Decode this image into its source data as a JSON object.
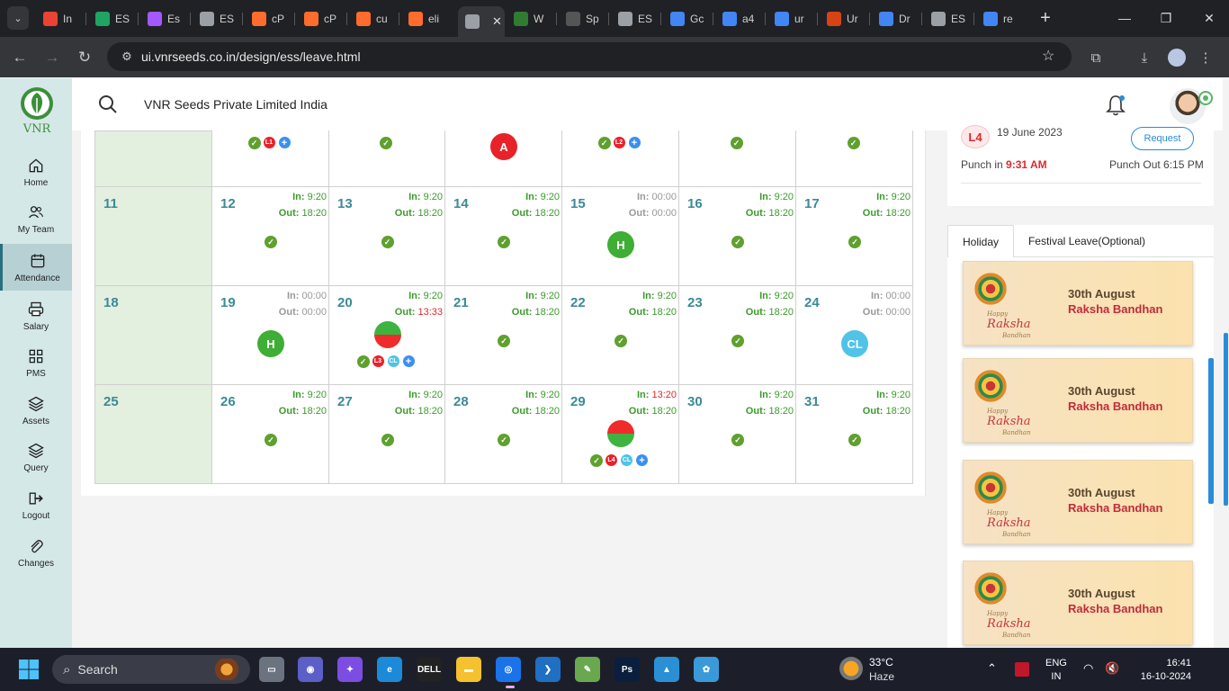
{
  "browser": {
    "tabs": [
      {
        "title": "In",
        "icon": "gmail-icon",
        "color": "#ea4335"
      },
      {
        "title": "ES",
        "icon": "sheets-icon",
        "color": "#1fa463"
      },
      {
        "title": "Es",
        "icon": "figma-icon",
        "color": "#a259ff"
      },
      {
        "title": "ES",
        "icon": "globe-icon",
        "color": "#9aa0a6"
      },
      {
        "title": "cP",
        "icon": "cpanel-icon",
        "color": "#ff6c2c"
      },
      {
        "title": "cP",
        "icon": "cpanel-icon",
        "color": "#ff6c2c"
      },
      {
        "title": "cu",
        "icon": "cpanel-icon",
        "color": "#ff6c2c"
      },
      {
        "title": "eli",
        "icon": "cpanel-icon",
        "color": "#ff6c2c"
      },
      {
        "title": "",
        "icon": "globe-icon",
        "color": "#9aa0a6",
        "active": true
      },
      {
        "title": "W",
        "icon": "chart-icon",
        "color": "#2e7d32"
      },
      {
        "title": "Sp",
        "icon": "spreadsheet-icon",
        "color": "#555"
      },
      {
        "title": "ES",
        "icon": "globe-icon",
        "color": "#9aa0a6"
      },
      {
        "title": "Gc",
        "icon": "google-icon",
        "color": "#4285f4"
      },
      {
        "title": "a4",
        "icon": "google-icon",
        "color": "#4285f4"
      },
      {
        "title": "ur",
        "icon": "google-icon",
        "color": "#4285f4"
      },
      {
        "title": "Ur",
        "icon": "kiu-icon",
        "color": "#d84315"
      },
      {
        "title": "Dr",
        "icon": "google-icon",
        "color": "#4285f4"
      },
      {
        "title": "ES",
        "icon": "globe-icon",
        "color": "#9aa0a6"
      },
      {
        "title": "re",
        "icon": "google-icon",
        "color": "#4285f4"
      }
    ],
    "url": "ui.vnrseeds.co.in/design/ess/leave.html"
  },
  "sidebar": {
    "logo_text": "VNR",
    "items": [
      {
        "label": "Home",
        "icon": "home-icon"
      },
      {
        "label": "My Team",
        "icon": "team-icon"
      },
      {
        "label": "Attendance",
        "icon": "calendar-icon",
        "active": true
      },
      {
        "label": "Salary",
        "icon": "printer-icon"
      },
      {
        "label": "PMS",
        "icon": "grid-icon"
      },
      {
        "label": "Assets",
        "icon": "layers-icon"
      },
      {
        "label": "Query",
        "icon": "layers-icon"
      },
      {
        "label": "Logout",
        "icon": "logout-icon"
      },
      {
        "label": "Changes",
        "icon": "paperclip-icon"
      }
    ]
  },
  "header": {
    "company": "VNR Seeds Private Limited India"
  },
  "calendar": {
    "top_row": [
      {
        "marks": [
          "check",
          "L1",
          "plus"
        ]
      },
      {
        "marks": [
          "check"
        ]
      },
      {
        "bubble": "A",
        "color": "#e8222a"
      },
      {
        "marks": [
          "check",
          "L2",
          "plus"
        ]
      },
      {
        "marks": [
          "check"
        ]
      },
      {
        "marks": [
          "check"
        ]
      }
    ],
    "weeks": [
      [
        {
          "day": "11",
          "sunday": true
        },
        {
          "day": "12",
          "in": "9:20",
          "out": "18:20",
          "status": "check"
        },
        {
          "day": "13",
          "in": "9:20",
          "out": "18:20",
          "status": "check"
        },
        {
          "day": "14",
          "in": "9:20",
          "out": "18:20",
          "status": "check"
        },
        {
          "day": "15",
          "in": "00:00",
          "out": "00:00",
          "grey": true,
          "bubble": "H",
          "bubble_color": "#3fae34"
        },
        {
          "day": "16",
          "in": "9:20",
          "out": "18:20",
          "status": "check"
        },
        {
          "day": "17",
          "in": "9:20",
          "out": "18:20",
          "status": "check"
        }
      ],
      [
        {
          "day": "18",
          "sunday": true
        },
        {
          "day": "19",
          "in": "00:00",
          "out": "00:00",
          "grey": true,
          "bubble": "H",
          "bubble_color": "#3fae34"
        },
        {
          "day": "20",
          "in": "9:20",
          "out": "13:33",
          "out_red": true,
          "split": "green-top",
          "marks": [
            "check",
            "L3",
            "CL",
            "plus"
          ]
        },
        {
          "day": "21",
          "in": "9:20",
          "out": "18:20",
          "status": "check"
        },
        {
          "day": "22",
          "in": "9:20",
          "out": "18:20",
          "status": "check"
        },
        {
          "day": "23",
          "in": "9:20",
          "out": "18:20",
          "status": "check"
        },
        {
          "day": "24",
          "in": "00:00",
          "out": "00:00",
          "grey": true,
          "bubble": "CL",
          "bubble_color": "#4fc3e8"
        }
      ],
      [
        {
          "day": "25",
          "sunday": true
        },
        {
          "day": "26",
          "in": "9:20",
          "out": "18:20",
          "status": "check"
        },
        {
          "day": "27",
          "in": "9:20",
          "out": "18:20",
          "status": "check"
        },
        {
          "day": "28",
          "in": "9:20",
          "out": "18:20",
          "status": "check"
        },
        {
          "day": "29",
          "in": "13:20",
          "in_red": true,
          "out": "18:20",
          "split": "red-top",
          "marks": [
            "check",
            "L4",
            "CL",
            "plus"
          ]
        },
        {
          "day": "30",
          "in": "9:20",
          "out": "18:20",
          "status": "check"
        },
        {
          "day": "31",
          "in": "9:20",
          "out": "18:20",
          "status": "check"
        }
      ]
    ],
    "in_label": "In:",
    "out_label": "Out:"
  },
  "request_card": {
    "badge": "L4",
    "date": "19 June 2023",
    "button": "Request",
    "punch_in_label": "Punch in",
    "punch_in_time": "9:31 AM",
    "punch_out": "Punch Out 6:15 PM"
  },
  "holidays": {
    "tabs": [
      "Holiday",
      "Festival Leave(Optional)"
    ],
    "cards": [
      {
        "date": "30th August",
        "name": "Raksha Bandhan",
        "art_script": "Raksha",
        "art_top": "Happy",
        "art_bottom": "Bandhan"
      },
      {
        "date": "30th August",
        "name": "Raksha Bandhan",
        "art_script": "Raksha",
        "art_top": "Happy",
        "art_bottom": "Bandhan"
      },
      {
        "date": "30th August",
        "name": "Raksha Bandhan",
        "art_script": "Raksha",
        "art_top": "Happy",
        "art_bottom": "Bandhan"
      },
      {
        "date": "30th August",
        "name": "Raksha Bandhan",
        "art_script": "Raksha",
        "art_top": "Happy",
        "art_bottom": "Bandhan"
      }
    ]
  },
  "taskbar": {
    "search": "Search",
    "temp": "33°C",
    "weather": "Haze",
    "lang1": "ENG",
    "lang2": "IN",
    "time": "16:41",
    "date": "16-10-2024"
  },
  "colors": {
    "accent": "#3b8a97",
    "sidebar": "#d5e8e8",
    "green": "#3a9b2a",
    "red": "#e0292a"
  }
}
